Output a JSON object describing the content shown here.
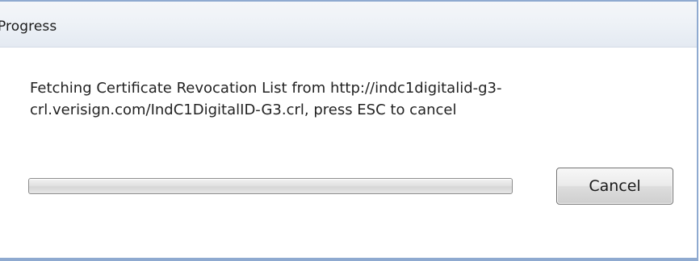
{
  "window": {
    "title": "Progress",
    "frame_color": "#8faad0"
  },
  "message": {
    "text": "Fetching Certificate Revocation List from http://indc1digitalid-g3-crl.verisign.com/IndC1DigitalID-G3.crl, press ESC to cancel"
  },
  "progress": {
    "value": 0
  },
  "buttons": {
    "cancel_label": "Cancel"
  }
}
